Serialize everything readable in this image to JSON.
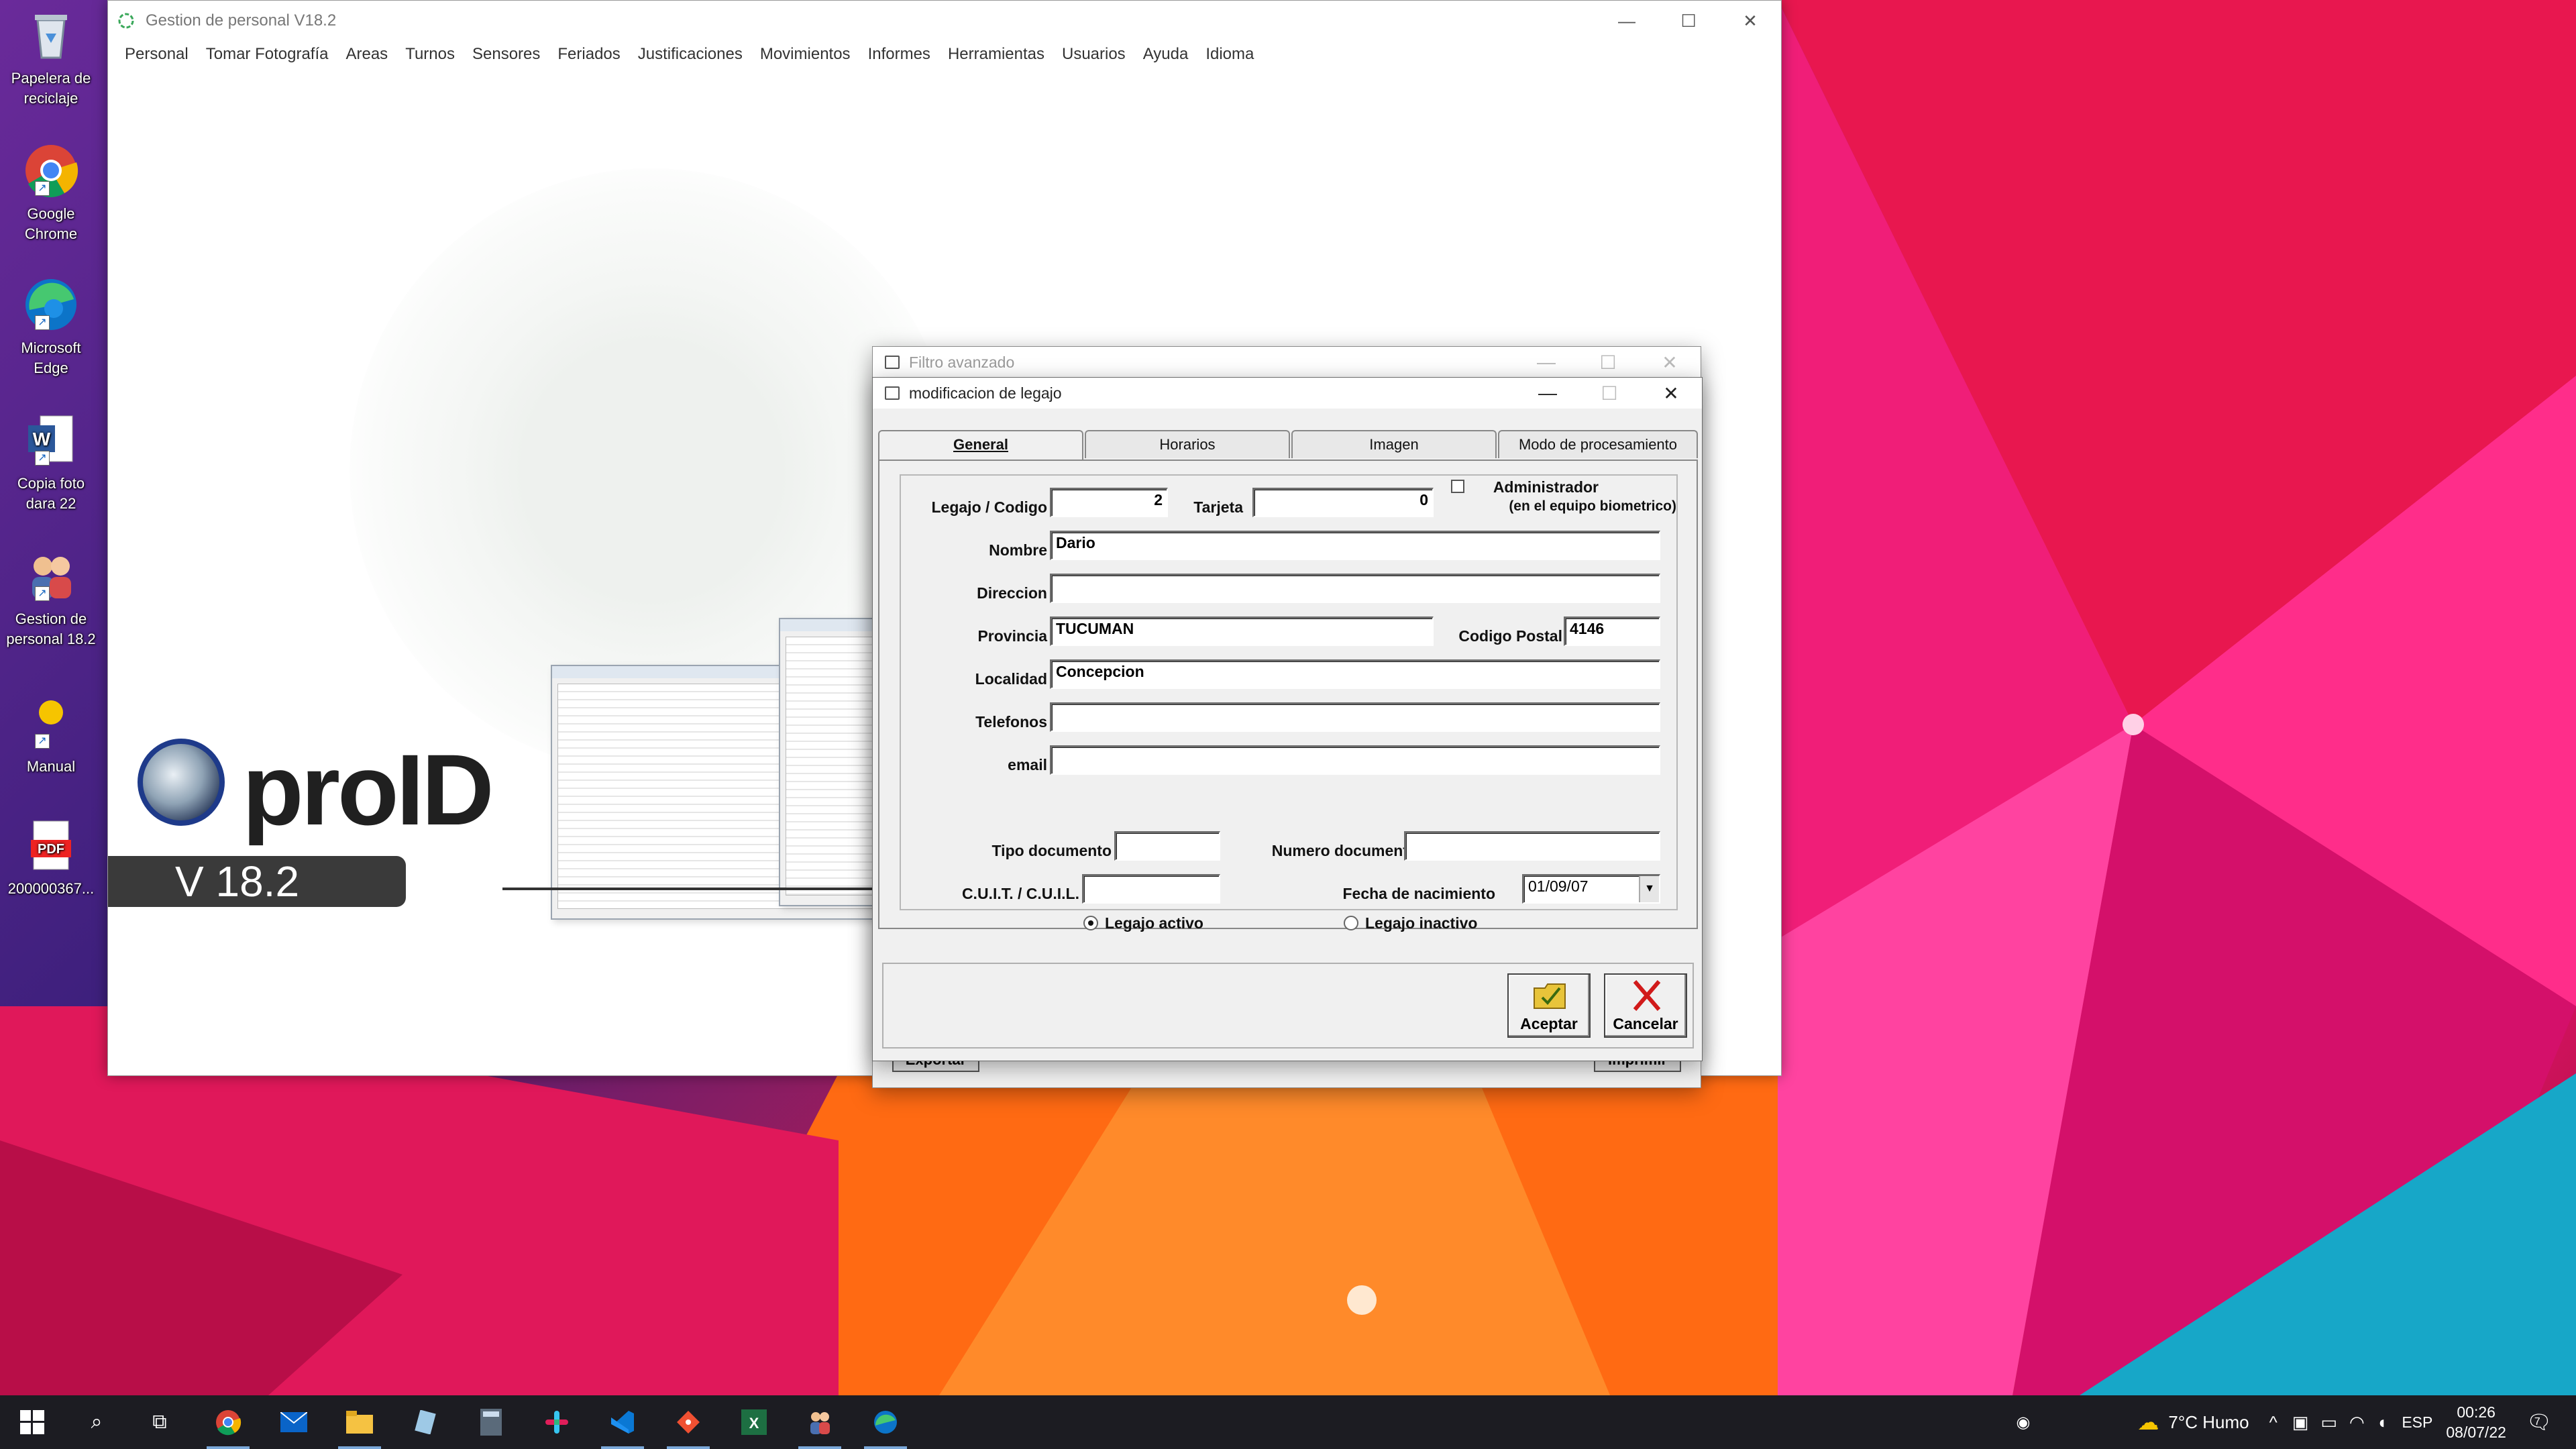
{
  "desktop": {
    "icons": [
      {
        "label": "Papelera de reciclaje",
        "icon": "recycle-bin-icon"
      },
      {
        "label": "Google Chrome",
        "icon": "chrome-icon"
      },
      {
        "label": "Microsoft Edge",
        "icon": "edge-icon"
      },
      {
        "label": "Copia foto dara 22",
        "icon": "word-doc-icon"
      },
      {
        "label": "Gestion de personal 18.2",
        "icon": "users-icon"
      },
      {
        "label": "Manual",
        "icon": "manual-icon"
      },
      {
        "label": "200000367...",
        "icon": "pdf-icon"
      }
    ]
  },
  "main_window": {
    "title": "Gestion de personal V18.2",
    "menu": [
      "Personal",
      "Tomar Fotografía",
      "Areas",
      "Turnos",
      "Sensores",
      "Feriados",
      "Justificaciones",
      "Movimientos",
      "Informes",
      "Herramientas",
      "Usuarios",
      "Ayuda",
      "Idioma"
    ],
    "logo_text": "proID",
    "version": "V 18.2"
  },
  "filtro_dialog": {
    "title": "Filtro avanzado",
    "export_label": "Exportar",
    "print_label": "Imprimir"
  },
  "legajo_dialog": {
    "title": "modificacion de legajo",
    "tabs": [
      "General",
      "Horarios",
      "Imagen",
      "Modo de procesamiento"
    ],
    "active_tab": "General",
    "labels": {
      "legajo": "Legajo / Codigo",
      "tarjeta": "Tarjeta",
      "admin": "Administrador",
      "admin_note": "(en el equipo biometrico)",
      "nombre": "Nombre",
      "direccion": "Direccion",
      "provincia": "Provincia",
      "codigo_postal": "Codigo Postal",
      "localidad": "Localidad",
      "telefonos": "Telefonos",
      "email": "email",
      "tipo_documento": "Tipo documento",
      "numero_documento": "Numero documento",
      "cuit": "C.U.I.T. / C.U.I.L.",
      "fecha_nacimiento": "Fecha de nacimiento",
      "legajo_activo": "Legajo activo",
      "legajo_inactivo": "Legajo inactivo"
    },
    "values": {
      "legajo": "2",
      "tarjeta": "0",
      "admin_checked": false,
      "nombre": "Dario",
      "direccion": "",
      "provincia": "TUCUMAN",
      "codigo_postal": "4146",
      "localidad": "Concepcion",
      "telefonos": "",
      "email": "",
      "tipo_documento": "",
      "numero_documento": "",
      "cuit": "",
      "fecha_nacimiento": "01/09/07",
      "estado": "activo"
    },
    "buttons": {
      "aceptar": "Aceptar",
      "cancelar": "Cancelar"
    }
  },
  "taskbar": {
    "weather": "7°C Humo",
    "language": "ESP",
    "time": "00:26",
    "date": "08/07/22",
    "notifications": "7"
  },
  "colors": {
    "accept_icon": "#e8c43a",
    "cancel_icon": "#d11a1a",
    "taskbar": "#1c1c22"
  }
}
